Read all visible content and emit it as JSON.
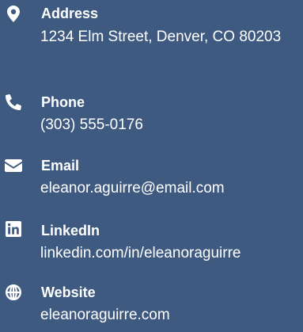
{
  "contacts": [
    {
      "icon": "map-pin-icon",
      "label": "Address",
      "value": "1234 Elm Street, Denver, CO 80203"
    },
    {
      "icon": "phone-icon",
      "label": "Phone",
      "value": "(303) 555-0176"
    },
    {
      "icon": "envelope-icon",
      "label": "Email",
      "value": "eleanor.aguirre@email.com"
    },
    {
      "icon": "linkedin-icon",
      "label": "LinkedIn",
      "value": "linkedin.com/in/eleanoraguirre"
    },
    {
      "icon": "globe-icon",
      "label": "Website",
      "value": "eleanoraguirre.com"
    }
  ],
  "colors": {
    "background": "#3e5a80",
    "text": "#ffffff"
  }
}
